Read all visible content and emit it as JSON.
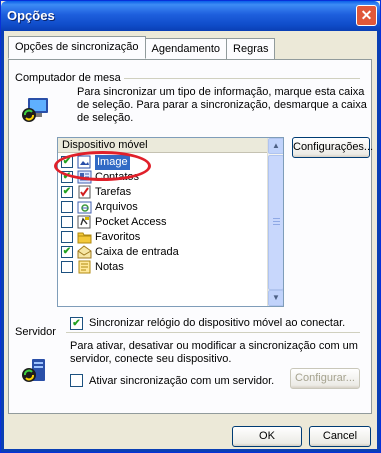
{
  "window": {
    "title": "Opções",
    "close_label": "✕"
  },
  "tabs": [
    {
      "label": "Opções de sincronização"
    },
    {
      "label": "Agendamento"
    },
    {
      "label": "Regras"
    }
  ],
  "desktop": {
    "group_label": "Computador de mesa",
    "description_line1": "Para sincronizar um tipo de informação, marque esta caixa",
    "description_line2": "de seleção. Para parar a sincronização, desmarque a caixa",
    "description_line3": "de seleção."
  },
  "list": {
    "header": "Dispositivo móvel",
    "items": [
      {
        "label": "Image",
        "checked": true,
        "icon": "image-icon"
      },
      {
        "label": "Contatos",
        "checked": true,
        "icon": "contacts-icon"
      },
      {
        "label": "Tarefas",
        "checked": true,
        "icon": "tasks-icon"
      },
      {
        "label": "Arquivos",
        "checked": false,
        "icon": "files-icon"
      },
      {
        "label": "Pocket Access",
        "checked": false,
        "icon": "pocket-access-icon"
      },
      {
        "label": "Favoritos",
        "checked": false,
        "icon": "favorites-icon"
      },
      {
        "label": "Caixa de entrada",
        "checked": true,
        "icon": "inbox-icon"
      },
      {
        "label": "Notas",
        "checked": false,
        "icon": "notes-icon"
      }
    ],
    "selected_index": 0
  },
  "settings_button": "Configurações...",
  "sync_clock": {
    "label": "Sincronizar relógio do dispositivo móvel ao conectar.",
    "checked": true
  },
  "server": {
    "group_label": "Servidor",
    "description_line1": "Para ativar, desativar ou modificar a sincronização com um",
    "description_line2": "servidor, conecte seu dispositivo.",
    "enable_label": "Ativar sincronização com um servidor.",
    "enable_checked": false,
    "configure_button": "Configurar..."
  },
  "footer": {
    "ok_label": "OK",
    "cancel_label": "Cancel"
  },
  "colors": {
    "titlebar": "#0a5fe8",
    "selection": "#316ac5",
    "highlight": "#e0202a",
    "check": "#21a121"
  }
}
